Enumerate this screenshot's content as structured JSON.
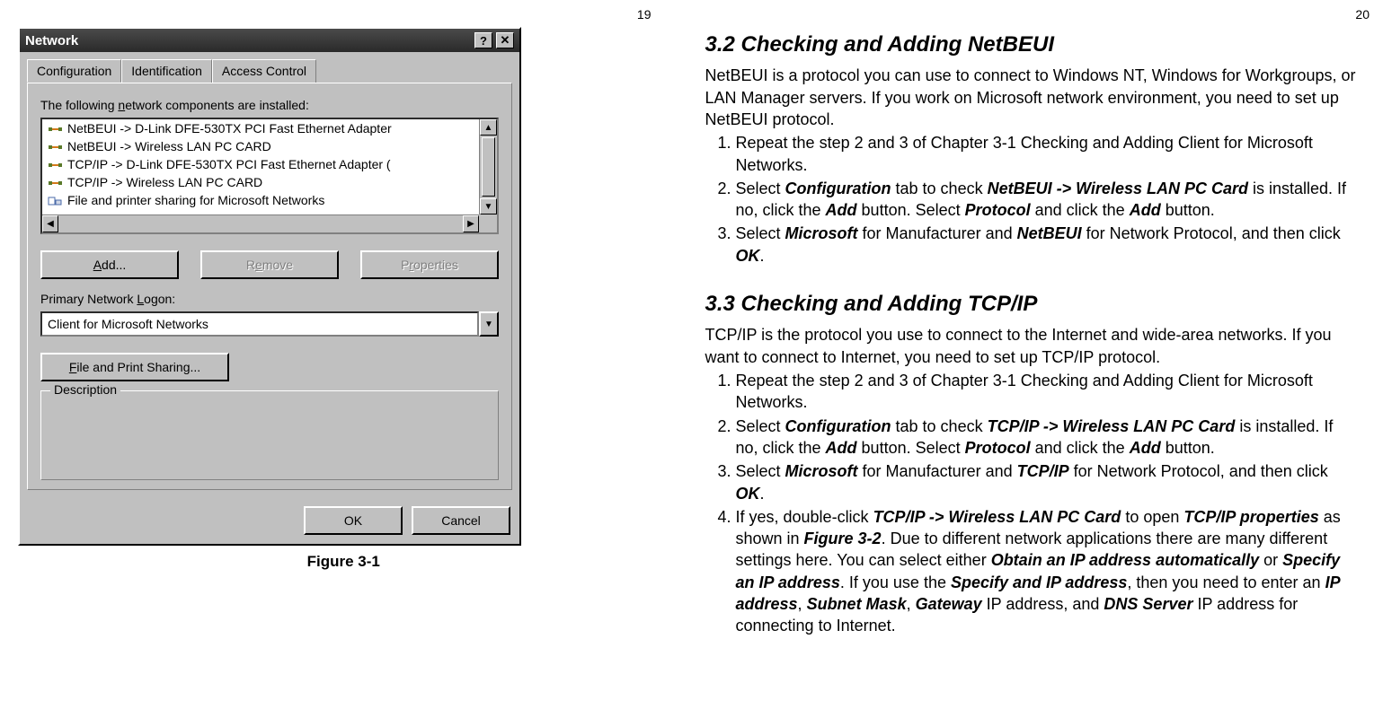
{
  "page_numbers": {
    "left": "19",
    "right": "20"
  },
  "dialog": {
    "title": "Network",
    "help_icon": "?",
    "close_icon": "✕",
    "tabs": [
      "Configuration",
      "Identification",
      "Access Control"
    ],
    "active_tab": 0,
    "components_label": "The following network components are installed:",
    "components": [
      "NetBEUI -> D-Link DFE-530TX PCI Fast Ethernet Adapter",
      "NetBEUI -> Wireless LAN PC CARD",
      "TCP/IP -> D-Link DFE-530TX PCI Fast Ethernet Adapter (",
      "TCP/IP -> Wireless LAN PC CARD",
      "File and printer sharing for Microsoft Networks"
    ],
    "buttons": {
      "add": "Add...",
      "remove": "Remove",
      "properties": "Properties"
    },
    "logon_label": "Primary Network Logon:",
    "logon_value": "Client for Microsoft Networks",
    "share_button": "File and Print Sharing...",
    "description_label": "Description",
    "ok": "OK",
    "cancel": "Cancel"
  },
  "figure_caption": "Figure 3-1",
  "section32": {
    "heading": "3.2    Checking and Adding NetBEUI",
    "intro": "NetBEUI is a protocol you can use to connect to Windows NT, Windows for Workgroups, or LAN Manager servers. If you work on Microsoft network environment, you need to set up NetBEUI protocol.",
    "steps": [
      {
        "plain": "Repeat the step 2 and 3 of Chapter 3-1 Checking and Adding Client for Microsoft Networks."
      },
      {
        "parts": [
          "Select ",
          {
            "bi": "Configuration"
          },
          " tab to check ",
          {
            "bi": "NetBEUI -> Wireless LAN PC Card"
          },
          " is installed. If no, click the ",
          {
            "bi": "Add"
          },
          " button. Select ",
          {
            "bi": "Protocol"
          },
          " and click the ",
          {
            "bi": "Add"
          },
          " button."
        ]
      },
      {
        "parts": [
          "Select ",
          {
            "bi": "Microsoft"
          },
          " for Manufacturer and ",
          {
            "bi": "NetBEUI"
          },
          " for Network Protocol, and then click ",
          {
            "bi": "OK"
          },
          "."
        ]
      }
    ]
  },
  "section33": {
    "heading": "3.3    Checking and Adding TCP/IP",
    "intro": "TCP/IP is the protocol you use to connect to the Internet and wide-area networks. If you want to connect to Internet, you need to set up TCP/IP protocol.",
    "steps": [
      {
        "plain": "Repeat the step 2 and 3 of Chapter 3-1 Checking and Adding Client for Microsoft Networks."
      },
      {
        "parts": [
          "Select ",
          {
            "bi": "Configuration"
          },
          " tab to check ",
          {
            "bi": "TCP/IP -> Wireless LAN PC Card"
          },
          " is installed. If no, click the ",
          {
            "bi": "Add"
          },
          " button. Select ",
          {
            "bi": "Protocol"
          },
          " and click the ",
          {
            "bi": "Add"
          },
          " button."
        ]
      },
      {
        "parts": [
          "Select ",
          {
            "bi": "Microsoft"
          },
          " for Manufacturer and ",
          {
            "bi": "TCP/IP"
          },
          " for Network Protocol, and then click ",
          {
            "bi": "OK"
          },
          "."
        ]
      },
      {
        "parts": [
          "If yes, double-click ",
          {
            "bi": "TCP/IP -> Wireless LAN PC Card"
          },
          " to open ",
          {
            "bi": "TCP/IP properties"
          },
          " as shown in ",
          {
            "bi": "Figure 3-2"
          },
          ". Due to different network applications there are many different settings here. You can select either ",
          {
            "bi": "Obtain an IP address automatically"
          },
          " or ",
          {
            "bi": "Specify an IP address"
          },
          ". If you use the ",
          {
            "bi": "Specify and IP address"
          },
          ", then you need to enter an ",
          {
            "bi": "IP address"
          },
          ", ",
          {
            "bi": "Subnet Mask"
          },
          ", ",
          {
            "bi": "Gateway"
          },
          " IP address, and ",
          {
            "bi": "DNS Server"
          },
          " IP address for connecting to Internet."
        ]
      }
    ]
  }
}
